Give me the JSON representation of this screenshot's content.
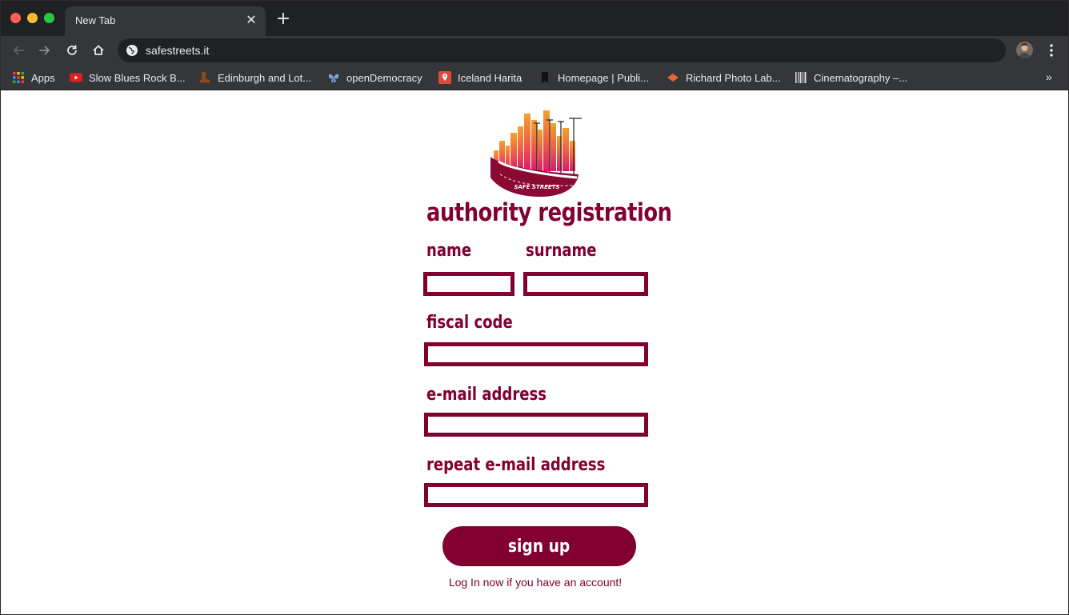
{
  "browser": {
    "tab_title": "New Tab",
    "url": "safestreets.it",
    "bookmarks": [
      {
        "label": "Apps",
        "icon": "apps-grid-icon"
      },
      {
        "label": "Slow Blues Rock B...",
        "icon": "youtube-icon"
      },
      {
        "label": "Edinburgh and Lot...",
        "icon": "boot-icon"
      },
      {
        "label": "openDemocracy",
        "icon": "butterfly-icon"
      },
      {
        "label": "Iceland Harita",
        "icon": "map-pin-icon"
      },
      {
        "label": "Homepage | Publi...",
        "icon": "bookmark-icon"
      },
      {
        "label": "Richard Photo Lab...",
        "icon": "diamond-icon"
      },
      {
        "label": "Cinematography –...",
        "icon": "barcode-icon"
      }
    ],
    "more_bookmarks": "»"
  },
  "form": {
    "logo_text": "SAFE STREETS",
    "title": "authority registration",
    "name_label": "name",
    "surname_label": "surname",
    "fiscal_code_label": "fiscal code",
    "email_label": "e-mail address",
    "repeat_email_label": "repeat e-mail address",
    "name_value": "",
    "surname_value": "",
    "fiscal_code_value": "",
    "email_value": "",
    "repeat_email_value": "",
    "signup_label": "sign up",
    "login_link": "Log In now if you have an account!"
  },
  "colors": {
    "brand": "#820030",
    "chrome_dark": "#202124",
    "chrome_mid": "#35363a"
  }
}
